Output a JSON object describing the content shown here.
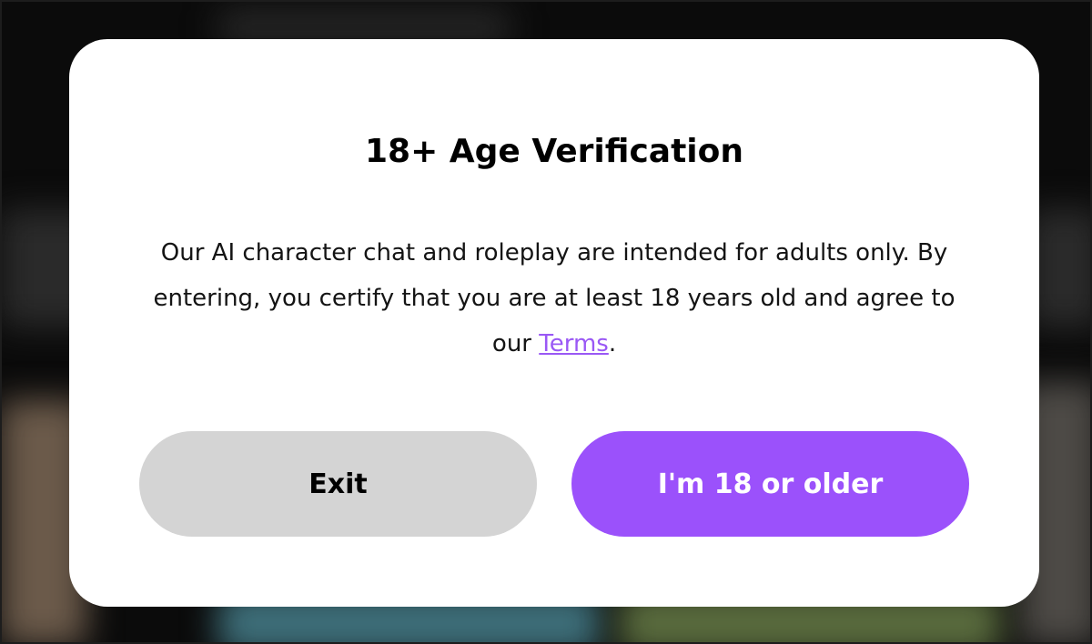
{
  "dialog": {
    "title": "18+ Age Verification",
    "body_text_before_link": "Our AI character chat and roleplay are intended for adults only. By entering, you certify that you are at least 18 years old and agree to our ",
    "terms_link_label": "Terms",
    "body_text_after_link": ".",
    "exit_label": "Exit",
    "confirm_label": "I'm 18 or older"
  },
  "colors": {
    "dialog_background": "#ffffff",
    "link": "#9a58f5",
    "exit_button": "#d4d4d4",
    "confirm_button": "#9b51fb",
    "confirm_text": "#ffffff"
  }
}
